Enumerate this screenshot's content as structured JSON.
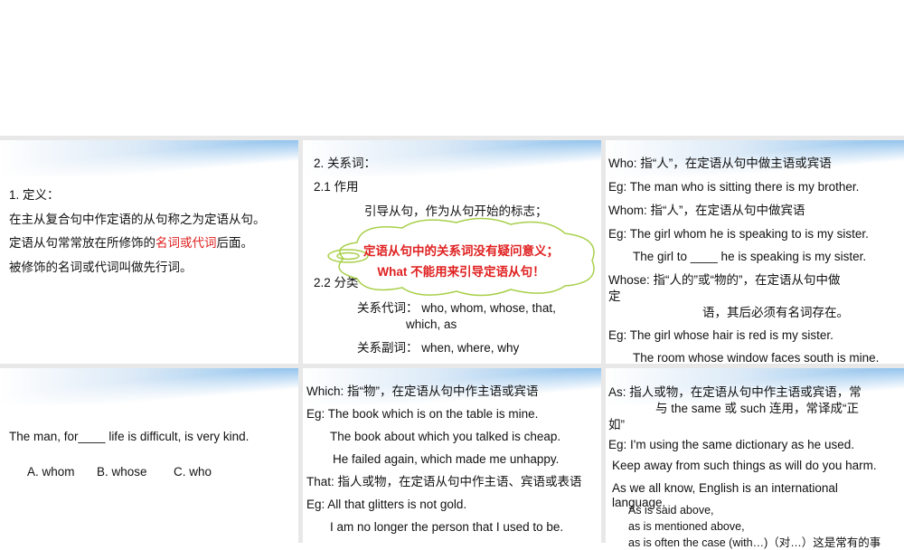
{
  "slide1": {
    "heading": "1. 定义：",
    "line1": "在主从复合句中作定语的从句称之为定语从句。",
    "line2_pre": "定语从句常常放在所修饰的",
    "line2_red": "名词或代词",
    "line2_post": "后面。",
    "line3": "被修饰的名词或代词叫做先行词。"
  },
  "slide2": {
    "heading": "2. 关系词：",
    "s21": "2.1  作用",
    "s21_text": "引导从句，作为从句开始的标志；",
    "s22": "2.2  分类",
    "pron": "关系代词：  who, whom, whose, that,",
    "pron2": "which, as",
    "adv": "关系副词：  when, where, why",
    "callout1": "定语从句中的关系词没有疑问意义；",
    "callout2": "What 不能用来引导定语从句！"
  },
  "slide3": {
    "l1": "Who:  指“人”，在定语从句中做主语或宾语",
    "l2": "Eg: The man who is sitting there is my brother.",
    "l3": "Whom:  指“人”，在定语从句中做宾语",
    "l4": "Eg: The girl whom he is speaking to is my sister.",
    "l5": "The girl to ____ he is speaking is my sister.",
    "l6": "Whose:  指“人的”或“物的”，在定语从句中做",
    "l6b": "定",
    "l7": "语，其后必须有名词存在。",
    "l8": "Eg: The girl whose hair is red is my sister.",
    "l9": "The room whose window faces south is mine."
  },
  "slide4": {
    "question": "The man, for____ life is difficult, is very kind.",
    "a": "A. whom",
    "b": "B. whose",
    "c": "C. who"
  },
  "slide5": {
    "l1": "Which:  指“物”，在定语从句中作主语或宾语",
    "l2": "Eg: The book which is on the table is mine.",
    "l3": "The book about which you talked is cheap.",
    "l4": "He failed again, which made me unhappy.",
    "l5": "That:  指人或物，在定语从句中作主语、宾语或表语",
    "l6": "Eg: All that glitters is not gold.",
    "l7": "I am no longer the person that I used to be."
  },
  "slide6": {
    "l1": "As:  指人或物，在定语从句中作主语或宾语，常",
    "l2": "与 the same  或   such 连用，常译成“正",
    "l3": "如”",
    "l4": "Eg: I'm using the same dictionary as he used.",
    "l5": "Keep away from such things as will do you harm.",
    "l6": "As we all know, English is an international",
    "l7": "language.",
    "l8": "As is said above,",
    "l9": "as is mentioned above,",
    "l10": "as is often the case (with…)（对…）这是常有的事"
  }
}
